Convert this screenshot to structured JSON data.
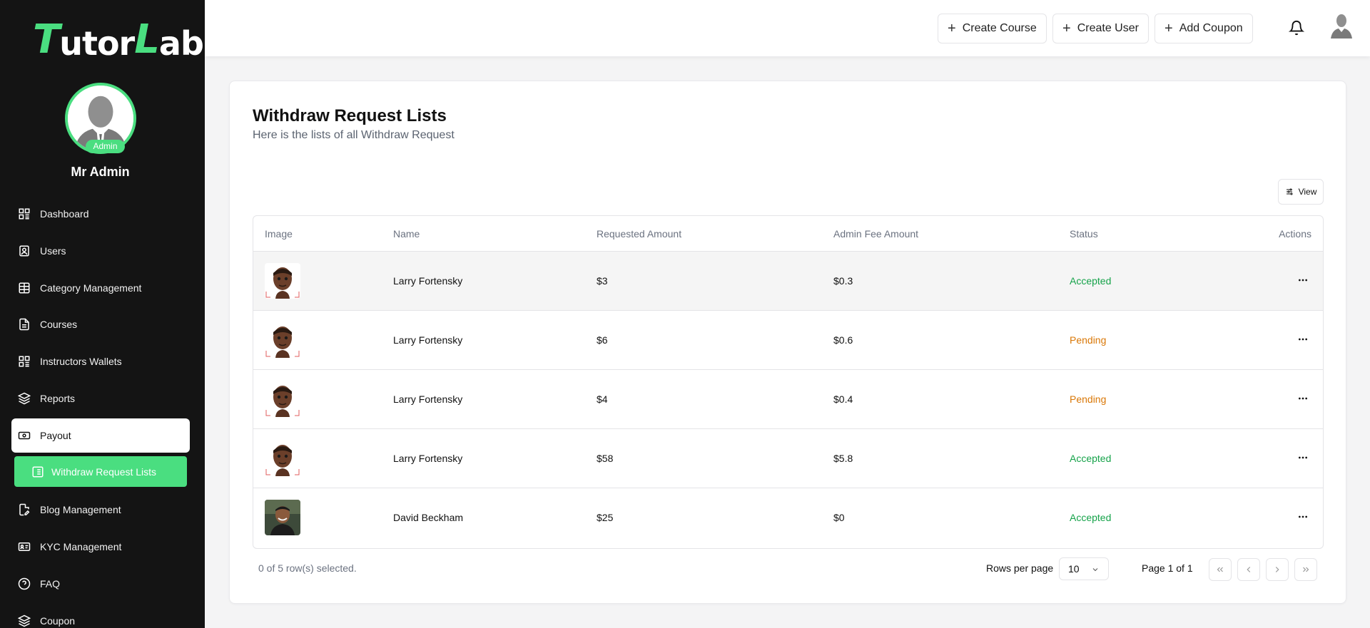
{
  "brand": {
    "logo_part1": "T",
    "logo_part2": "utor",
    "logo_part3": "L",
    "logo_part4": "ab"
  },
  "profile": {
    "role_badge": "Admin",
    "name": "Mr Admin"
  },
  "sidebar": {
    "items": [
      {
        "label": "Dashboard",
        "icon": "dashboard-icon"
      },
      {
        "label": "Users",
        "icon": "users-icon"
      },
      {
        "label": "Category Management",
        "icon": "table-icon"
      },
      {
        "label": "Courses",
        "icon": "file-icon"
      },
      {
        "label": "Instructors Wallets",
        "icon": "dashboard-icon"
      },
      {
        "label": "Reports",
        "icon": "layers-icon"
      },
      {
        "label": "Payout",
        "icon": "banknote-icon"
      },
      {
        "label": "Blog Management",
        "icon": "file-edit-icon"
      },
      {
        "label": "KYC Management",
        "icon": "id-card-icon"
      },
      {
        "label": "FAQ",
        "icon": "help-circle-icon"
      },
      {
        "label": "Coupon",
        "icon": "layers-icon"
      }
    ],
    "sub_item": {
      "label": "Withdraw Request Lists",
      "icon": "list-icon"
    }
  },
  "header": {
    "create_course": "Create Course",
    "create_user": "Create User",
    "add_coupon": "Add Coupon"
  },
  "page": {
    "title": "Withdraw Request Lists",
    "subtitle": "Here is the lists of all Withdraw Request",
    "view_button": "View"
  },
  "table": {
    "headers": {
      "image": "Image",
      "name": "Name",
      "requested": "Requested Amount",
      "fee": "Admin Fee Amount",
      "status": "Status",
      "actions": "Actions"
    },
    "rows": [
      {
        "name": "Larry Fortensky",
        "requested": "$3",
        "fee": "$0.3",
        "status": "Accepted"
      },
      {
        "name": "Larry Fortensky",
        "requested": "$6",
        "fee": "$0.6",
        "status": "Pending"
      },
      {
        "name": "Larry Fortensky",
        "requested": "$4",
        "fee": "$0.4",
        "status": "Pending"
      },
      {
        "name": "Larry Fortensky",
        "requested": "$58",
        "fee": "$5.8",
        "status": "Accepted"
      },
      {
        "name": "David Beckham",
        "requested": "$25",
        "fee": "$0",
        "status": "Accepted"
      }
    ]
  },
  "footer": {
    "selection": "0 of 5 row(s) selected.",
    "rows_per_page_label": "Rows per page",
    "rows_per_page_value": "10",
    "page_info": "Page 1 of 1"
  },
  "colors": {
    "accent": "#4ade80",
    "sidebar_bg": "#141414",
    "accepted": "#16a34a",
    "pending": "#d97706"
  }
}
